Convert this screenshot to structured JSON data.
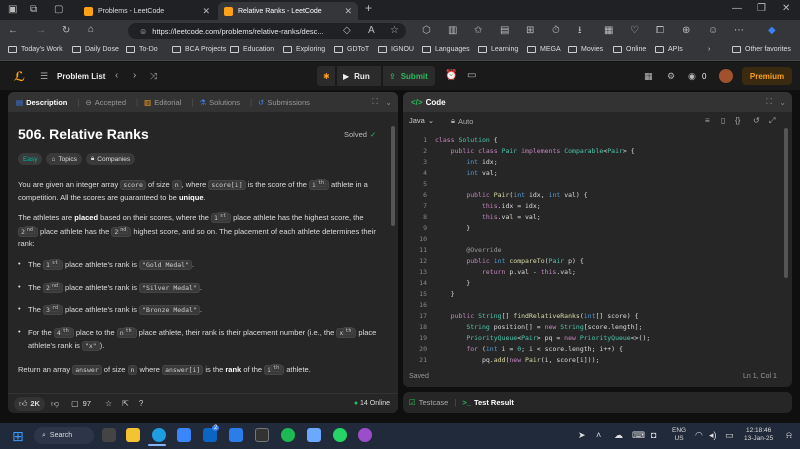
{
  "browser": {
    "tabs": [
      {
        "title": "Problems - LeetCode",
        "active": false
      },
      {
        "title": "Relative Ranks - LeetCode",
        "active": true
      }
    ],
    "new_tab": "+",
    "url": "https://leetcode.com/problems/relative-ranks/desc...",
    "bookmarks": [
      "Today's Work",
      "Daily Dose",
      "To-Do",
      "BCA Projects",
      "Education",
      "Exploring",
      "GDToT",
      "IGNOU",
      "Languages",
      "Learning",
      "MEGA",
      "Movies",
      "Online",
      "APIs"
    ],
    "more_bookmarks": "›",
    "other_bookmarks": "Other favorites"
  },
  "lc_nav": {
    "problem_list": "Problem List",
    "run": "Run",
    "submit": "Submit",
    "streak": "0",
    "premium": "Premium"
  },
  "left_panel": {
    "tabs": [
      {
        "label": "Description",
        "active": true
      },
      {
        "label": "Accepted",
        "active": false
      },
      {
        "label": "Editorial",
        "active": false
      },
      {
        "label": "Solutions",
        "active": false
      },
      {
        "label": "Submissions",
        "active": false
      }
    ],
    "title": "506. Relative Ranks",
    "status": "Solved",
    "chips": [
      "Easy",
      "Topics",
      "Companies"
    ],
    "footer": {
      "likes": "2K",
      "comments": "97",
      "online": "14 Online"
    }
  },
  "right_panel": {
    "title": "Code",
    "language": "Java",
    "mode": "Auto",
    "status": "Saved",
    "cursor": "Ln 1, Col 1",
    "testcase": "Testcase",
    "test_result": "Test Result"
  },
  "taskbar": {
    "search": "Search",
    "lang": "ENG",
    "region": "US",
    "time": "12:18:46",
    "date": "13-Jan-25",
    "badge": "2"
  },
  "colors": {
    "accent": "#ffa116",
    "easy": "#00b8a3",
    "run_green": "#2cbb5d",
    "solved": "#2cbb5d"
  }
}
